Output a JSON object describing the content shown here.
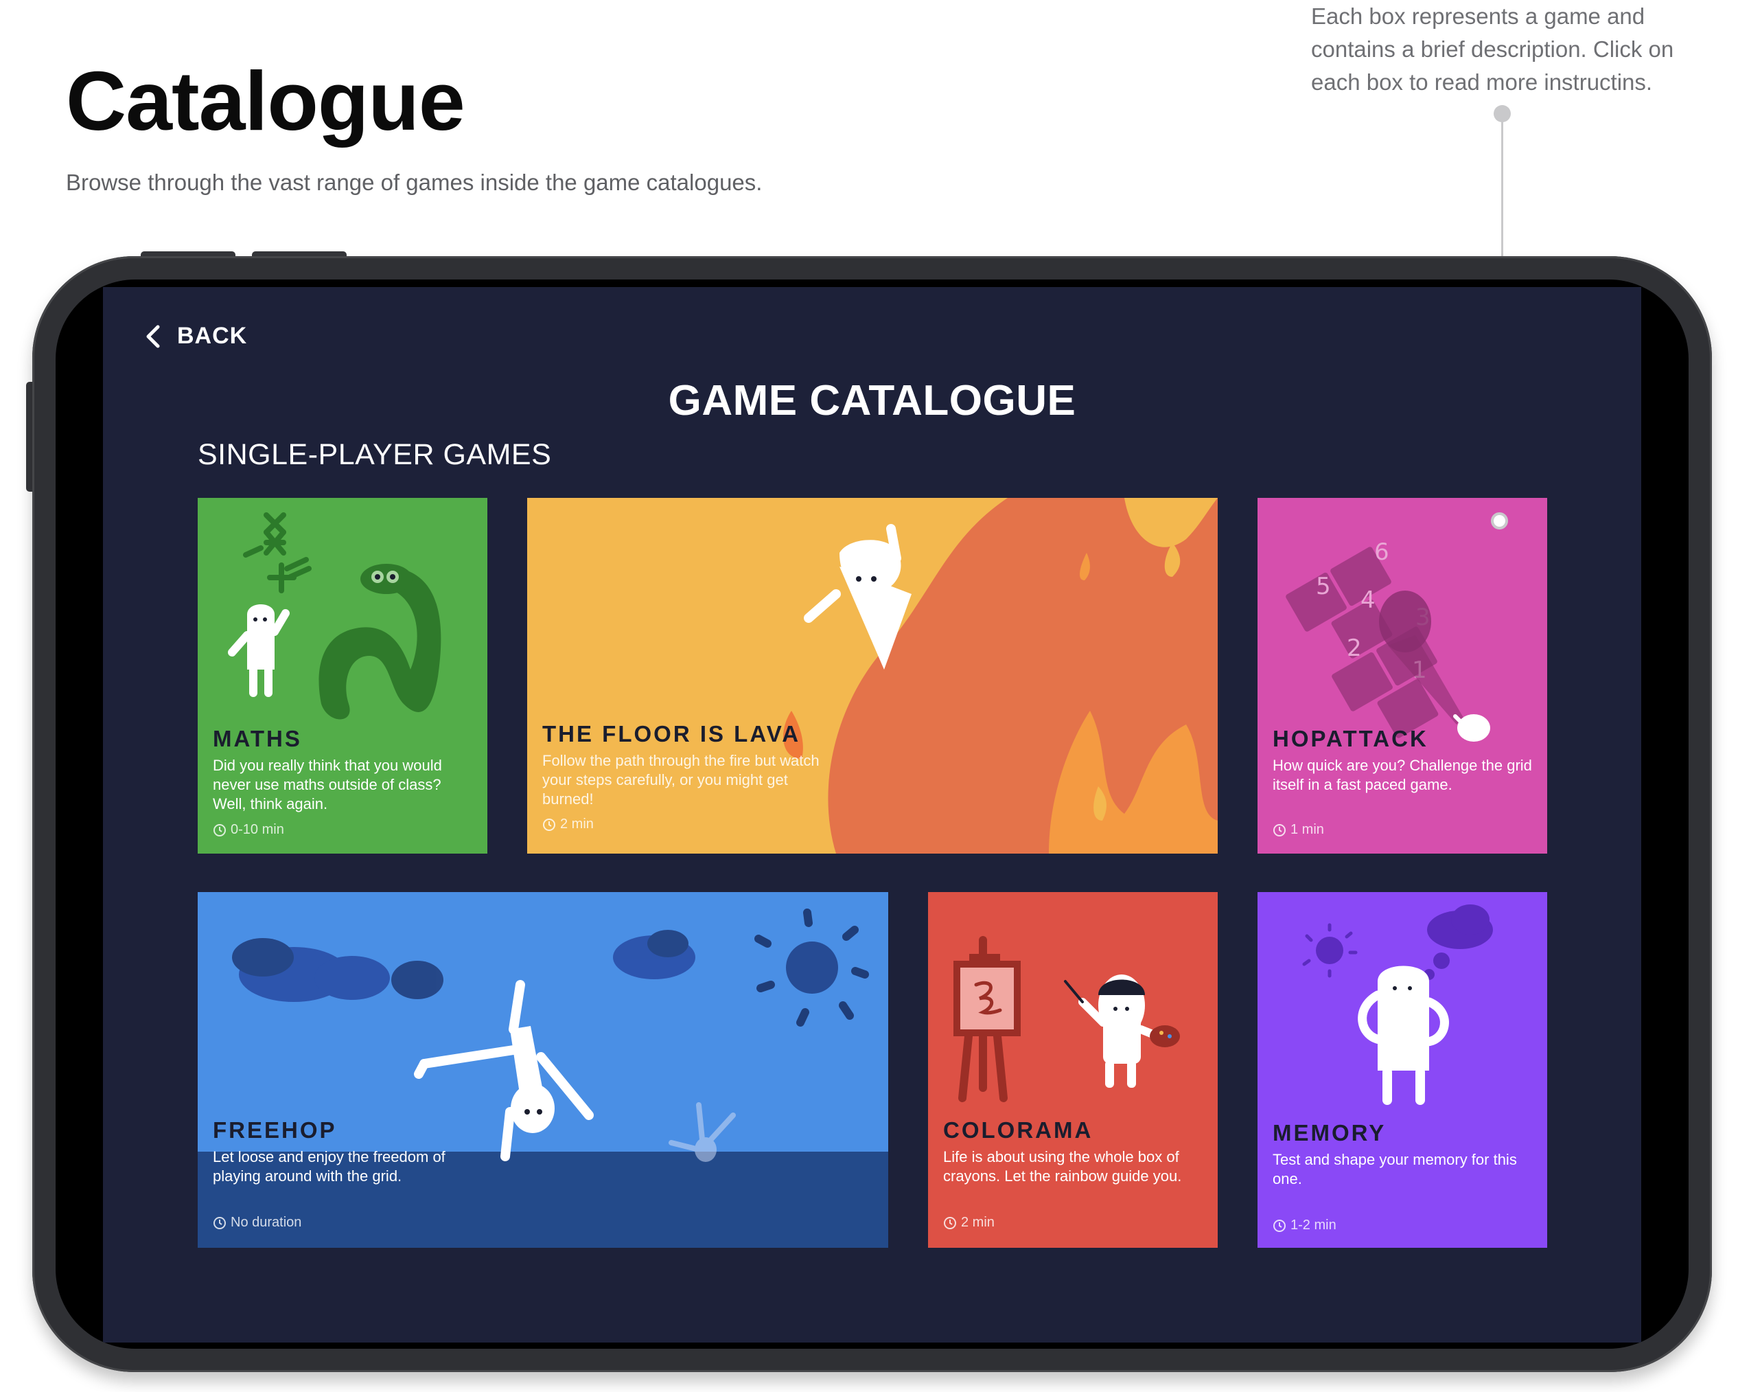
{
  "header": {
    "title": "Catalogue",
    "subtitle": "Browse through the vast range of games inside the game catalogues.",
    "annotation": "Each box represents a game and contains a brief description. Click on each box to read more instructins."
  },
  "app": {
    "back_label": "BACK",
    "title": "GAME CATALOGUE",
    "section_label": "SINGLE-PLAYER GAMES"
  },
  "cards": [
    {
      "title": "MATHS",
      "description": "Did you really think that you would never use maths outside of class? Well, think again.",
      "duration": "0-10 min",
      "color": "#53ad49"
    },
    {
      "title": "THE FLOOR IS LAVA",
      "description": "Follow the path through the fire but watch your steps carefully, or you might get burned!",
      "duration": "2 min",
      "color": "#f3b84f"
    },
    {
      "title": "HOPATTACK",
      "description": "How quick are you? Challenge the grid itself in a fast paced game.",
      "duration": "1 min",
      "color": "#d64fad"
    },
    {
      "title": "FREEHOP",
      "description": "Let loose and enjoy the freedom of playing around with the grid.",
      "duration": "No duration",
      "color": "#4a8fe5"
    },
    {
      "title": "COLORAMA",
      "description": "Life is about using the whole box of crayons. Let the rainbow guide you.",
      "duration": "2 min",
      "color": "#dd5145"
    },
    {
      "title": "MEMORY",
      "description": "Test and shape your memory for this one.",
      "duration": "1-2 min",
      "color": "#8a49f6"
    }
  ],
  "icons": {
    "back": "chevron-left-icon",
    "duration": "clock-icon"
  }
}
